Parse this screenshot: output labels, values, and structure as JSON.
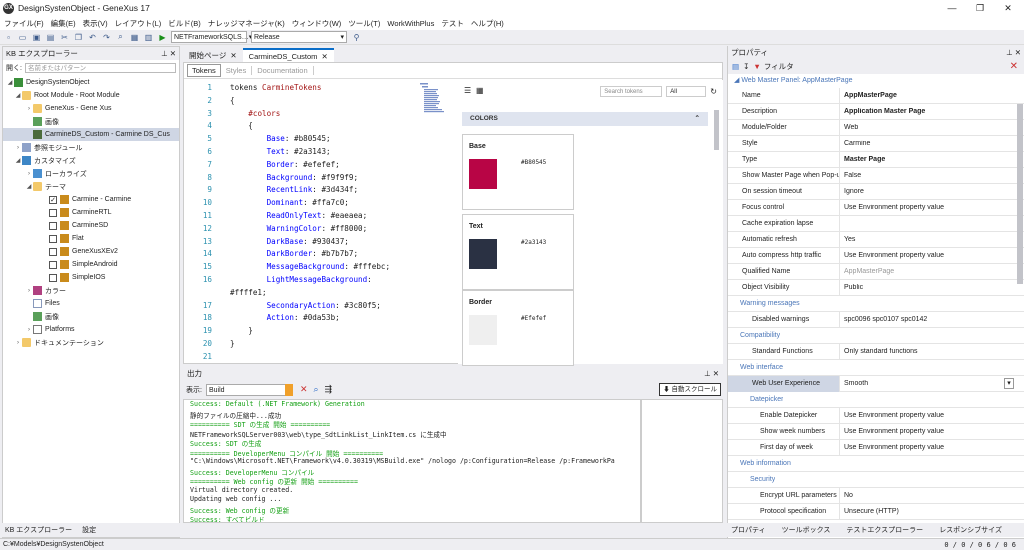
{
  "window": {
    "title": "DesignSystenObject - GeneXus 17",
    "icon_text": "GX",
    "min": "—",
    "max": "❐",
    "close": "✕"
  },
  "menu": [
    "ファイル(F)",
    "編集(E)",
    "表示(V)",
    "レイアウト(L)",
    "ビルド(B)",
    "ナレッジマネージャ(K)",
    "ウィンドウ(W)",
    "ツール(T)",
    "WorkWithPlus",
    "テスト",
    "ヘルプ(H)"
  ],
  "toolbar": {
    "env": "NETFrameworkSQLS…",
    "config": "Release"
  },
  "kb": {
    "title": "KB エクスプローラー",
    "search_label": "開く:",
    "search_placeholder": "名前またはパターン",
    "items": [
      "DesignSystenObject",
      "Root Module - Root Module",
      "GeneXus - Gene Xus",
      "画像",
      "CarmineDS_Custom - Carmine DS_Cus",
      "参照モジュール",
      "カスタマイズ",
      "ローカライズ",
      "テーマ",
      "Carmine - Carmine",
      "CarmineRTL",
      "CarmineSD",
      "Flat",
      "GeneXusXEv2",
      "SimpleAndroid",
      "SimpleIOS",
      "カラー",
      "Files",
      "画像",
      "Platforms",
      "ドキュメンテーション"
    ],
    "bottom_tabs": [
      "KB エクスプローラー",
      "設定"
    ]
  },
  "tabs": [
    "開始ページ",
    "CarmineDS_Custom"
  ],
  "subtabs": [
    "Tokens",
    "Styles",
    "Documentation"
  ],
  "code": {
    "line_numbers": [
      "1",
      "2",
      "3",
      "4",
      "5",
      "6",
      "7",
      "8",
      "9",
      "10",
      "11",
      "12",
      "13",
      "14",
      "15",
      "16",
      "",
      "17",
      "18",
      "19",
      "20",
      "21"
    ],
    "lines": [
      [
        "tokens ",
        "CarmineTokens",
        ""
      ],
      [
        "{",
        "",
        ""
      ],
      [
        "    ",
        "#colors",
        ""
      ],
      [
        "    {",
        "",
        ""
      ],
      [
        "        ",
        "Base",
        ": #b80545;"
      ],
      [
        "        ",
        "Text",
        ": #2a3143;"
      ],
      [
        "        ",
        "Border",
        ": #efefef;"
      ],
      [
        "        ",
        "Background",
        ": #f9f9f9;"
      ],
      [
        "        ",
        "RecentLink",
        ": #3d434f;"
      ],
      [
        "        ",
        "Dominant",
        ": #ffa7c0;"
      ],
      [
        "        ",
        "ReadOnlyText",
        ": #eaeaea;"
      ],
      [
        "        ",
        "WarningColor",
        ": #ff8000;"
      ],
      [
        "        ",
        "DarkBase",
        ": #930437;"
      ],
      [
        "        ",
        "DarkBorder",
        ": #b7b7b7;"
      ],
      [
        "        ",
        "MessageBackground",
        ": #fffebc;"
      ],
      [
        "        ",
        "LightMessageBackground",
        ":"
      ],
      [
        "#ffffe1;",
        "",
        ""
      ],
      [
        "        ",
        "SecondaryAction",
        ": #3c80f5;"
      ],
      [
        "        ",
        "Action",
        ": #0da53b;"
      ],
      [
        "    }",
        "",
        ""
      ],
      [
        "}",
        "",
        ""
      ],
      [
        "",
        "",
        ""
      ]
    ]
  },
  "preview": {
    "search_placeholder": "Search tokens",
    "filter": "All",
    "section": "COLORS",
    "cards": [
      {
        "name": "Base",
        "hex": "#B80545",
        "color": "#b80545"
      },
      {
        "name": "Text",
        "hex": "#2a3143",
        "color": "#2a3143"
      },
      {
        "name": "Border",
        "hex": "#Efefef",
        "color": "#efefef"
      }
    ]
  },
  "output": {
    "title": "出力",
    "show_label": "表示:",
    "source": "Build",
    "autoscroll": "自動スクロール",
    "lines": [
      [
        "g",
        "Success: Default (.NET Framework) Generation"
      ],
      [
        "d",
        "静的ファイルの圧縮中...成功"
      ],
      [
        "g",
        "========== SDT の生成 開始 =========="
      ],
      [
        "d",
        "NETFrameworkSQLServer003\\web\\type_SdtLinkList_LinkItem.cs に生成中"
      ],
      [
        "g",
        "Success: SDT の生成"
      ],
      [
        "g",
        "========== DeveloperMenu  コンパイル 開始 =========="
      ],
      [
        "d",
        "\"C:\\Windows\\Microsoft.NET\\Framework\\v4.0.30319\\MSBuild.exe\" /nologo /p:Configuration=Release /p:FrameworkPa"
      ],
      [
        "g",
        "Success: DeveloperMenu  コンパイル"
      ],
      [
        "g",
        "========== Web config の更新 開始 =========="
      ],
      [
        "d",
        "Virtual directory created."
      ],
      [
        "d",
        "Updating web config ..."
      ],
      [
        "g",
        "Success: Web config の更新"
      ],
      [
        "g",
        "Success: すべてビルド"
      ]
    ]
  },
  "props": {
    "title": "プロパティ",
    "filter_label": "フィルタ",
    "object_title": "Web Master Panel: AppMasterPage",
    "rows": [
      {
        "k": "Name",
        "v": "AppMasterPage",
        "t": "bold"
      },
      {
        "k": "Description",
        "v": "Application Master Page",
        "t": "bold"
      },
      {
        "k": "Module/Folder",
        "v": "Web",
        "t": ""
      },
      {
        "k": "Style",
        "v": "Carmine",
        "t": ""
      },
      {
        "k": "Type",
        "v": "Master Page",
        "t": "bold"
      },
      {
        "k": "Show Master Page when Pop-u",
        "v": "False",
        "t": ""
      },
      {
        "k": "On session timeout",
        "v": "Ignore",
        "t": ""
      },
      {
        "k": "Focus control",
        "v": "Use Environment property value",
        "t": ""
      },
      {
        "k": "Cache expiration lapse",
        "v": "",
        "t": ""
      },
      {
        "k": "Automatic refresh",
        "v": "Yes",
        "t": ""
      },
      {
        "k": "Auto compress http traffic",
        "v": "Use Environment property value",
        "t": ""
      },
      {
        "k": "Qualified Name",
        "v": "AppMasterPage",
        "t": "gray"
      },
      {
        "k": "Object Visibility",
        "v": "Public",
        "t": ""
      },
      {
        "k": "Warning messages",
        "v": "",
        "t": "grp"
      },
      {
        "k": "Disabled warnings",
        "v": "spc0096 spc0107 spc0142",
        "t": "sub"
      },
      {
        "k": "Compatibility",
        "v": "",
        "t": "grp"
      },
      {
        "k": "Standard Functions",
        "v": "Only standard functions",
        "t": "sub"
      },
      {
        "k": "Web interface",
        "v": "",
        "t": "grp"
      },
      {
        "k": "Web User Experience",
        "v": "Smooth",
        "t": "subhl"
      },
      {
        "k": "Datepicker",
        "v": "",
        "t": "subgrp"
      },
      {
        "k": "Enable Datepicker",
        "v": "Use Environment property value",
        "t": "subsub"
      },
      {
        "k": "Show week numbers",
        "v": "Use Environment property value",
        "t": "subsub"
      },
      {
        "k": "First day of week",
        "v": "Use Environment property value",
        "t": "subsub"
      },
      {
        "k": "Web information",
        "v": "",
        "t": "grp"
      },
      {
        "k": "Security",
        "v": "",
        "t": "subgrp"
      },
      {
        "k": "Encrypt URL parameters",
        "v": "No",
        "t": "subsub"
      },
      {
        "k": "Protocol specification",
        "v": "Unsecure (HTTP)",
        "t": "subsub"
      }
    ],
    "bottom_tabs": [
      "プロパティ",
      "ツールボックス",
      "テストエクスプローラー",
      "レスポンシブサイズ"
    ]
  },
  "status": {
    "path": "C:¥Models¥DesignSystenObject",
    "counts": "0 / 0 / 0 6 / 0 6"
  }
}
